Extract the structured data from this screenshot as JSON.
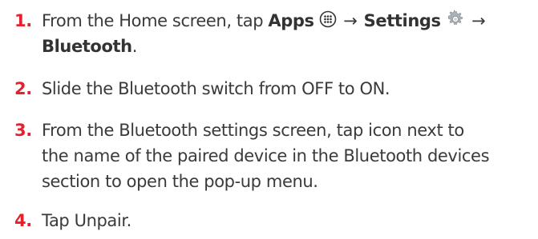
{
  "accent_color": "#e8202e",
  "steps": [
    {
      "number": "1.",
      "parts": {
        "lead": "From the Home screen, tap ",
        "apps_label": "Apps",
        "apps_icon": "apps-grid-icon",
        "arrow1": "→",
        "settings_label": "Settings",
        "settings_icon": "gear-icon",
        "arrow2": "→",
        "bluetooth_label": "Bluetooth",
        "period": "."
      }
    },
    {
      "number": "2.",
      "lines": [
        "Slide the Bluetooth switch from OFF to ON."
      ]
    },
    {
      "number": "3.",
      "lines": [
        "From the Bluetooth settings screen, tap icon next to",
        "the name of the paired device in the Bluetooth devices",
        "section to open the pop-up menu."
      ]
    },
    {
      "number": "4.",
      "lines": [
        "Tap Unpair."
      ]
    }
  ]
}
